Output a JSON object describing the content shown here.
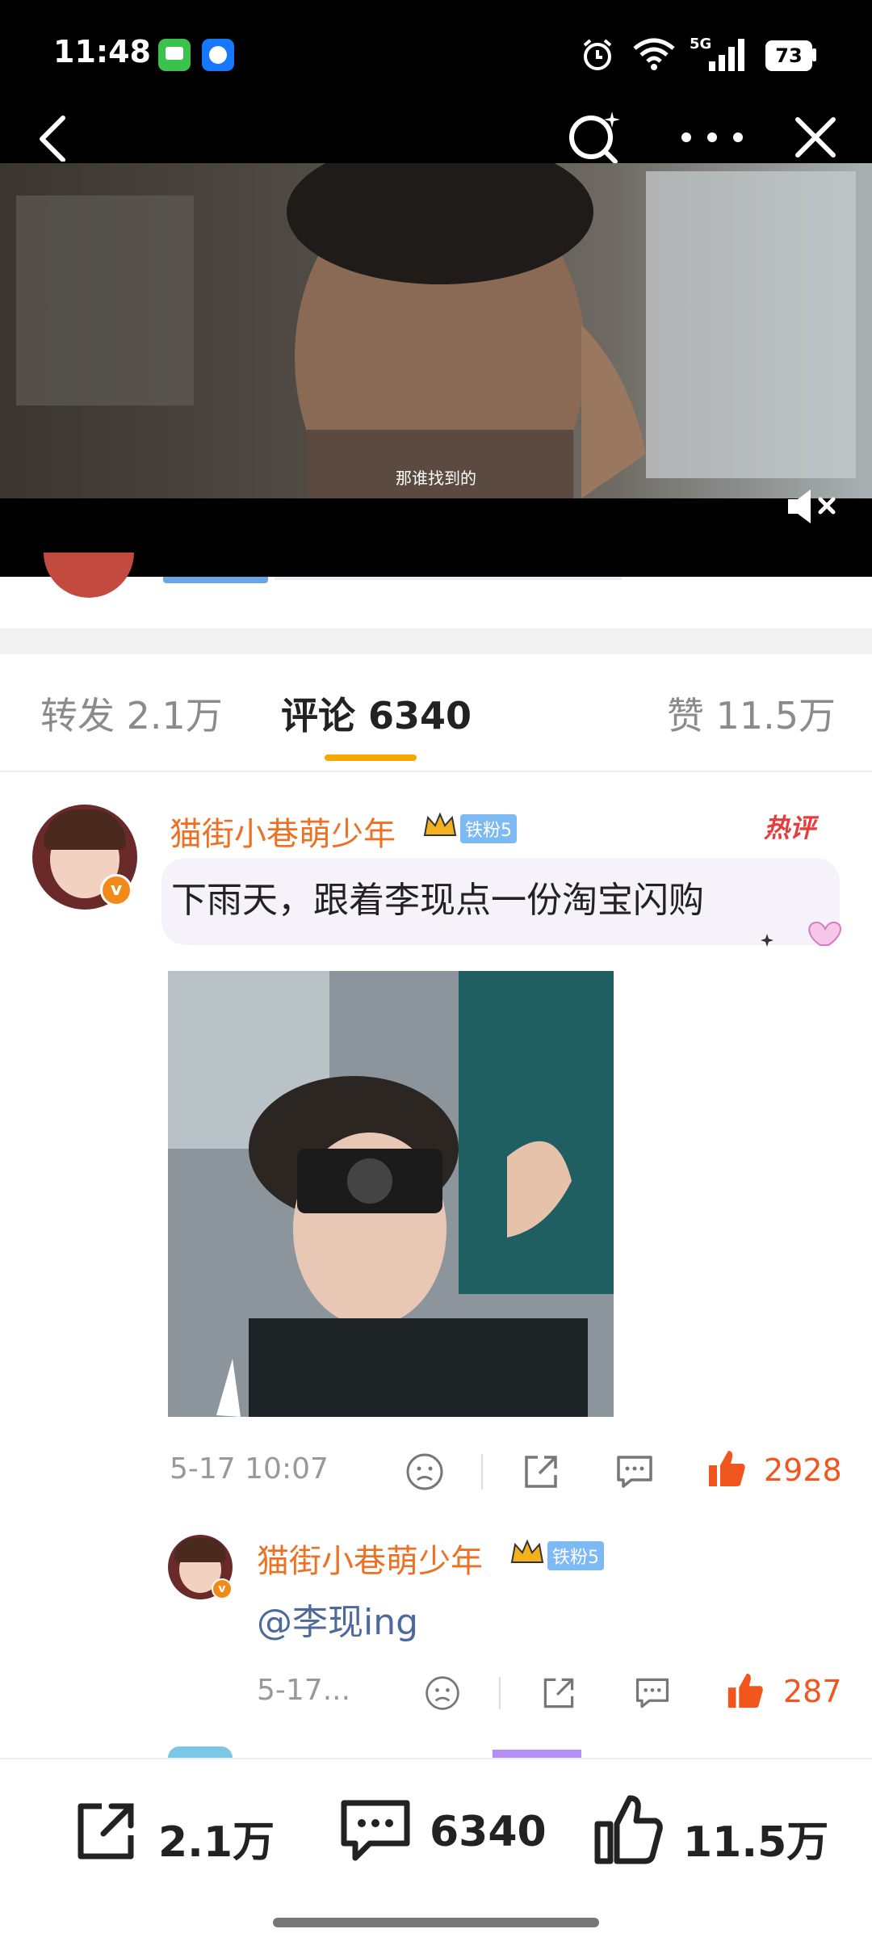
{
  "status_bar": {
    "time": "11:48",
    "signal": "5G",
    "battery": "73"
  },
  "video": {
    "subtitle": "那谁找到的"
  },
  "tabs": {
    "reposts": "转发 2.1万",
    "comments": "评论 6340",
    "likes": "赞 11.5万"
  },
  "comment": {
    "username": "猫街小巷萌少年",
    "fan_badge": "铁粉5",
    "hot_tag": "热评",
    "text": "下雨天，跟着李现点一份淘宝闪购",
    "time": "5-17 10:07",
    "likes": "2928"
  },
  "reply": {
    "username": "猫街小巷萌少年",
    "fan_badge": "铁粉5",
    "text": "@李现ing",
    "time": "5-17...",
    "likes": "287"
  },
  "bottom_bar": {
    "reposts": "2.1万",
    "comments": "6340",
    "likes": "11.5万"
  },
  "icons": [
    "back-icon",
    "search-icon",
    "more-icon",
    "close-icon",
    "mute-icon",
    "dislike-icon",
    "share-icon",
    "comment-icon",
    "like-icon"
  ]
}
